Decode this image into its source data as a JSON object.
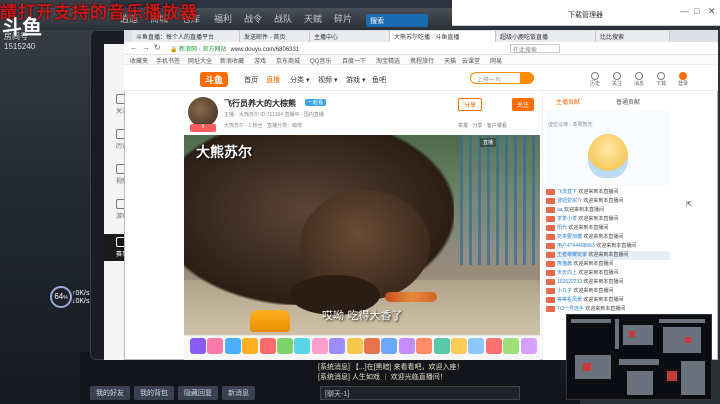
{
  "overlay": {
    "banner_text": "請打开支持的音乐播放器",
    "logo": "斗鱼",
    "room_label": "房间号",
    "room_number": "1515240",
    "fps_value": "64",
    "fps_unit": "%",
    "speed_up": "↑0K/s",
    "speed_down": "↓0K/s"
  },
  "background_tabs": [
    "逍遥",
    "商城",
    "仓库",
    "福利",
    "战令",
    "战队",
    "天赋",
    "碎片"
  ],
  "background_search": "搜索",
  "download_manager": {
    "title": "下载管理器",
    "min": "—",
    "max": "□",
    "close": "✕"
  },
  "browser": {
    "tabs": [
      {
        "label": "斗鱼直播：每个人的直播平台",
        "active": false
      },
      {
        "label": "发送邮件 - 首页",
        "active": false
      },
      {
        "label": "主播中心",
        "active": false
      },
      {
        "label": "大熊苏尔吃播 · 斗鱼直播",
        "active": true
      },
      {
        "label": "超级小鹿吃饭直播",
        "active": false
      },
      {
        "label": "比比搜索",
        "active": false
      }
    ],
    "url_secure": "🔒 新浪网 · 官方网站",
    "url": "www.douyu.com/6806331",
    "page_search": "在此搜索",
    "bookmarks": [
      "收藏夹",
      "手机书签",
      "网址大全",
      "新浪收藏",
      "游戏",
      "京东商城",
      "QQ音乐",
      "百度一下",
      "淘宝精选",
      "携程旅行",
      "天猫",
      "云课堂",
      "网易"
    ],
    "sidebar": [
      {
        "icon": "heart-icon",
        "label": "关注"
      },
      {
        "icon": "history-icon",
        "label": "历史"
      },
      {
        "icon": "video-icon",
        "label": "视频"
      },
      {
        "icon": "gamepad-icon",
        "label": "游戏"
      },
      {
        "icon": "trophy-icon",
        "label": "赛事"
      }
    ]
  },
  "douyu": {
    "logo": "斗鱼",
    "nav": [
      "首页",
      "直播",
      "分类 ▾",
      "视频 ▾",
      "游戏 ▾",
      "鱼吧"
    ],
    "search_placeholder": "上榜一鸟",
    "header_icons": [
      "历史",
      "关注",
      "消息",
      "下载",
      "登录"
    ],
    "streamer": {
      "title": "飞行员养大的大棕熊",
      "tag": "一起看",
      "meta": "主播：大熊苏尔  ID:711264  直播中 · 国内直播",
      "meta2": "大熊苏尔 · 1 粉丝  · 直播分类：萌宠",
      "badge": "5",
      "share": "分享",
      "follow": "关注",
      "report": "举报  · 分享 · 客户端看"
    },
    "video": {
      "watermark": "大熊苏尔",
      "subtitle": "哎呦 吃得大香了",
      "corner": "直播"
    },
    "chat": {
      "tabs": [
        "主播贡献",
        "普通贡献"
      ],
      "rank_title": "虚位以待 · 本周暂无",
      "rows": [
        {
          "user": "飞流直下",
          "msg": "欢迎来到本直播间",
          "highlight": false
        },
        {
          "user": "波妞爱宗介",
          "msg": "欢迎来到本直播间",
          "highlight": false
        },
        {
          "user": "aa",
          "msg": "欢迎来到本直播间",
          "highlight": false
        },
        {
          "user": "茶茶小茶",
          "msg": "欢迎来到本直播间",
          "highlight": false
        },
        {
          "user": "阳光",
          "msg": "欢迎来到本直播间",
          "highlight": false
        },
        {
          "user": "奶茶要加糖",
          "msg": "欢迎来到本直播间",
          "highlight": false
        },
        {
          "user": "用户4744498663",
          "msg": "欢迎来到本直播间",
          "highlight": false
        },
        {
          "user": "王者荣耀玩家",
          "msg": "欢迎来到本直播间",
          "highlight": true
        },
        {
          "user": "熊猫酱",
          "msg": "欢迎来到本直播间",
          "highlight": false
        },
        {
          "user": "天天向上",
          "msg": "欢迎来到本直播间",
          "highlight": false
        },
        {
          "user": "102622232",
          "msg": "欢迎来到本直播间",
          "highlight": false
        },
        {
          "user": "小丸子",
          "msg": "欢迎来到本直播间",
          "highlight": false
        },
        {
          "user": "等等看风景",
          "msg": "欢迎来到本直播间",
          "highlight": false
        },
        {
          "user": "TO一号选手",
          "msg": "欢迎来到本直播间",
          "highlight": false
        }
      ]
    },
    "gift_colors": [
      "#8a5cf6",
      "#ff7aa8",
      "#4ab0ff",
      "#ffb020",
      "#ff6a6a",
      "#7fd36b",
      "#5ad3e8",
      "#ff9dd0",
      "#9b8cff",
      "#f6c84a",
      "#e8724a",
      "#6aa8ff",
      "#c48cff",
      "#ff8a6a",
      "#58c8a8",
      "#ffcc55",
      "#8cc8ff",
      "#ff7070",
      "#9fe07a",
      "#d6a0ff"
    ]
  },
  "bottom": {
    "buttons": [
      "我的好友",
      "我的背包",
      "隐藏回复",
      "新消息"
    ],
    "chat_lines": [
      "[系统消息] 【...]在[黑暗] 来看看吧，欢迎入座！",
      "[系统消息] 人生如戏 ｜ 欢迎光临直播间！"
    ],
    "input": "[聊天-1]"
  },
  "colors": {
    "accent": "#ff6d00",
    "link": "#2e80d0",
    "overlay_red": "#c81818"
  }
}
